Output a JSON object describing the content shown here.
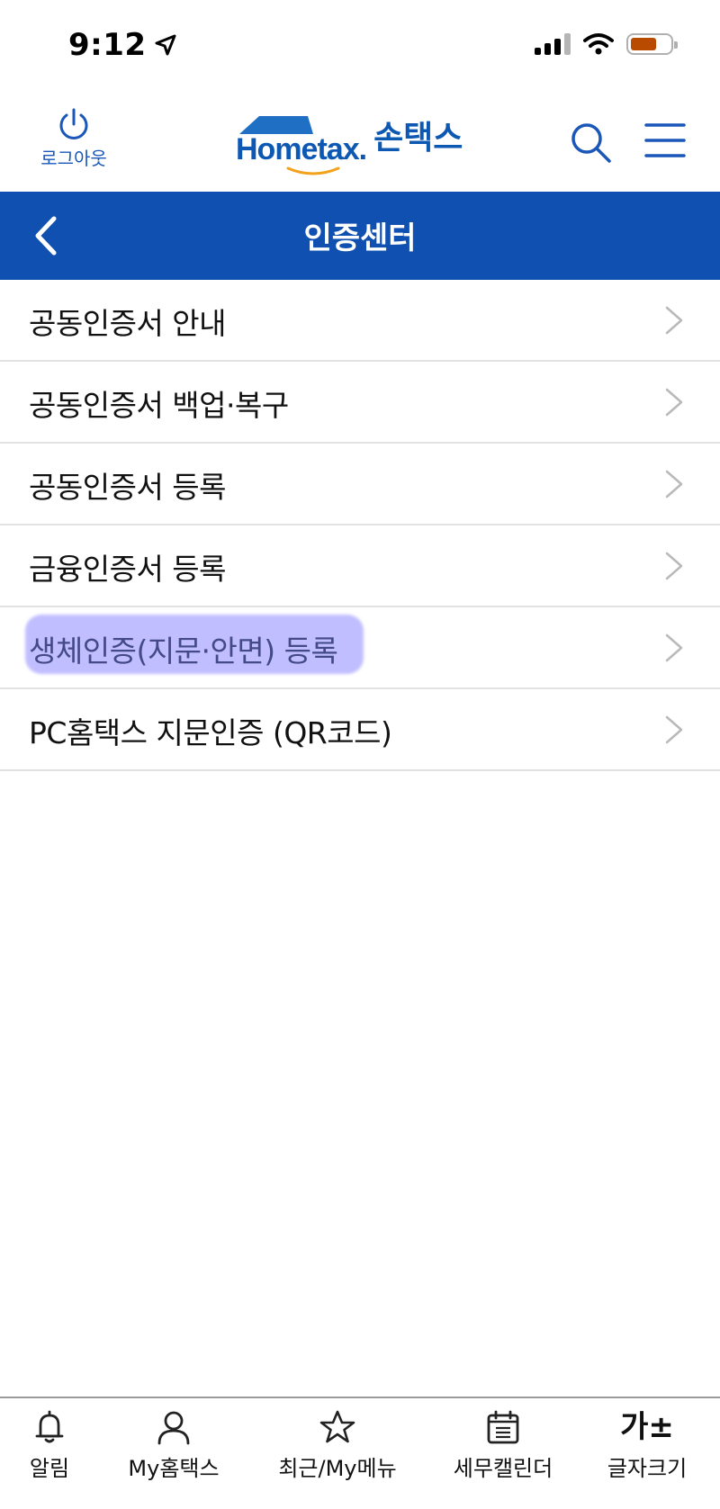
{
  "status_bar": {
    "time": "9:12",
    "battery_color": "#b84b00"
  },
  "header": {
    "logout_label": "로그아웃",
    "brand_name": "Hometax.",
    "brand_subtitle": "손택스",
    "brand_color": "#0d58b3",
    "search_icon": "search-icon",
    "menu_icon": "hamburger-menu-icon"
  },
  "title_bar": {
    "title": "인증센터",
    "background": "#1050b0"
  },
  "menu": {
    "items": [
      {
        "label": "공동인증서 안내"
      },
      {
        "label": "공동인증서 백업·복구"
      },
      {
        "label": "공동인증서 등록"
      },
      {
        "label": "금융인증서 등록"
      },
      {
        "label": "생체인증(지문·안면) 등록",
        "highlighted": true
      },
      {
        "label": "PC홈택스 지문인증 (QR코드)"
      }
    ]
  },
  "tab_bar": {
    "tabs": [
      {
        "label": "알림",
        "icon": "bell-icon"
      },
      {
        "label": "My홈택스",
        "icon": "user-icon"
      },
      {
        "label": "최근/My메뉴",
        "icon": "star-icon"
      },
      {
        "label": "세무캘린더",
        "icon": "calendar-icon"
      },
      {
        "label": "글자크기",
        "icon": "font-size-icon",
        "glyph": "가±"
      }
    ]
  }
}
